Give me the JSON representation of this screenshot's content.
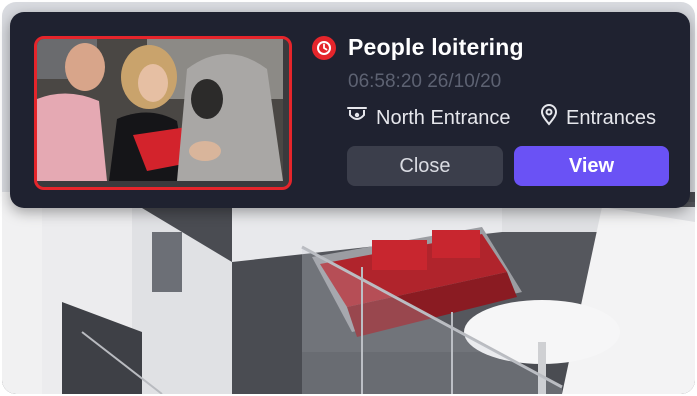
{
  "alert": {
    "title": "People loitering",
    "timestamp": "06:58:20 26/10/20",
    "camera_name": "North Entrance",
    "zone_name": "Entrances",
    "alert_icon": "clock-alert-icon",
    "camera_icon": "cctv-camera-icon",
    "zone_icon": "location-pin-icon",
    "thumbnail": "people-loitering-snapshot"
  },
  "actions": {
    "close_label": "Close",
    "view_label": "View"
  },
  "colors": {
    "card_bg": "#1f2230",
    "alert_red": "#e5252b",
    "primary_purple": "#6a52f5",
    "secondary_button": "#3b3e4b",
    "muted_text": "#5d6272"
  },
  "background": {
    "description_icon": "lobby-camera-feed"
  }
}
